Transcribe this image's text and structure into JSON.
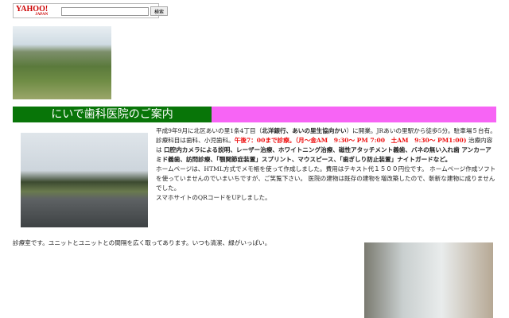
{
  "search": {
    "logo": "YAHOO! JAPAN",
    "logo_main": "YAHOO!",
    "logo_sub": "JAPAN",
    "value": "",
    "button": "検索"
  },
  "banner": {
    "title": "にいで歯科医院のご案内"
  },
  "description": {
    "p1": "平成9年9月に北区あいの里1条4丁目（",
    "p1b": "北洋銀行、あいの里生協向かい",
    "p2": "）に開業。JRあいの里駅から徒歩5分。駐車場５台有。診療科目は歯科、小児歯科。",
    "red": "午後7：00まで診療。（月～金AM　9:30～ PM 7:00　土AM　9:30～ PM1:00)",
    "p3": " 治療内容は ",
    "bold": "口腔内カメラによる説明、レーザー治療、ホワイトニング治療、磁性アタッチメント義歯、バネの無い入れ歯 アンカーアミド義歯、訪問診療、「顎関節症装置」スプリント、マウスピース、「歯ぎしり防止装置」ナイトガードなど。",
    "p4": "ホームページは、HTML方式でメモ帳を使って作成しました。費用はテキスト代１５００円位です。 ホームページ作成ソフトを使っていませんのでいまいちですが、ご笑覧下さい。 医院の建物は既存の建物を増改築したので、斬新な建物に成りませんでした。",
    "p5": "スマホサイトのQRコードをUPしました。"
  },
  "lower": {
    "text": "診療室です。ユニットとユニットとの間隔を広く取ってあります。いつも清潔、緑がいっぱい。"
  }
}
